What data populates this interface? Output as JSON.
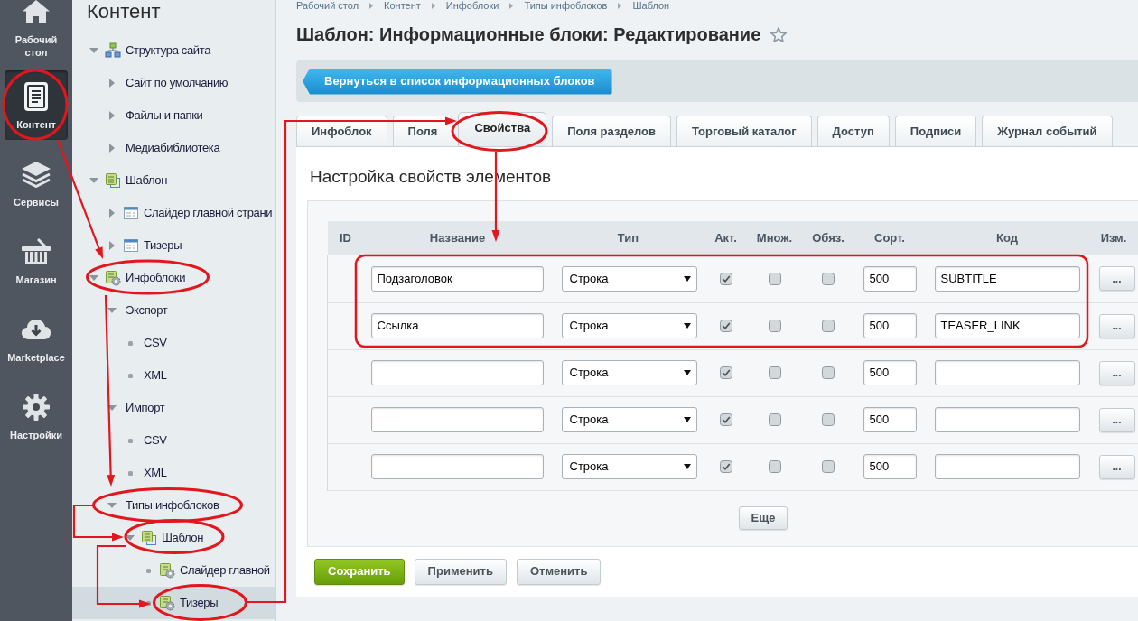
{
  "sidebar": {
    "items": [
      {
        "label": "Рабочий стол",
        "selected": false
      },
      {
        "label": "Контент",
        "selected": true
      },
      {
        "label": "Сервисы",
        "selected": false
      },
      {
        "label": "Магазин",
        "selected": false
      },
      {
        "label": "Marketplace",
        "selected": false
      },
      {
        "label": "Настройки",
        "selected": false
      }
    ]
  },
  "tree": {
    "title": "Контент",
    "items": [
      {
        "label": "Структура сайта",
        "kind": "structure",
        "expanded": true,
        "selected": false,
        "children": [
          {
            "label": "Сайт по умолчанию",
            "kind": "section",
            "expanded": false,
            "selected": false
          },
          {
            "label": "Файлы и папки",
            "kind": "section",
            "expanded": false,
            "selected": false
          },
          {
            "label": "Медиабиблиотека",
            "kind": "section",
            "expanded": false,
            "selected": false
          }
        ]
      },
      {
        "label": "Шаблон",
        "kind": "template",
        "expanded": true,
        "selected": false,
        "children": [
          {
            "label": "Слайдер главной страни",
            "kind": "iblock",
            "expanded": false,
            "selected": false
          },
          {
            "label": "Тизеры",
            "kind": "iblock",
            "expanded": false,
            "selected": false
          }
        ]
      },
      {
        "label": "Инфоблоки",
        "kind": "settings",
        "expanded": true,
        "selected": false,
        "children": [
          {
            "label": "Экспорт",
            "kind": "section",
            "expanded": true,
            "selected": false,
            "children": [
              {
                "label": "CSV",
                "kind": "page",
                "selected": false
              },
              {
                "label": "XML",
                "kind": "page",
                "selected": false
              }
            ]
          },
          {
            "label": "Импорт",
            "kind": "section",
            "expanded": true,
            "selected": false,
            "children": [
              {
                "label": "CSV",
                "kind": "page",
                "selected": false
              },
              {
                "label": "XML",
                "kind": "page",
                "selected": false
              }
            ]
          },
          {
            "label": "Типы инфоблоков",
            "kind": "section",
            "expanded": true,
            "selected": false,
            "children": [
              {
                "label": "Шаблон",
                "kind": "template",
                "expanded": true,
                "selected": false,
                "children": [
                  {
                    "label": "Слайдер главной",
                    "kind": "element",
                    "selected": false
                  },
                  {
                    "label": "Тизеры",
                    "kind": "element",
                    "selected": true
                  }
                ]
              }
            ]
          }
        ]
      }
    ]
  },
  "breadcrumbs": [
    "Рабочий стол",
    "Контент",
    "Инфоблоки",
    "Типы инфоблоков",
    "Шаблон"
  ],
  "page": {
    "title": "Шаблон: Информационные блоки: Редактирование",
    "starred": false
  },
  "back_button": "Вернуться в список информационных блоков",
  "tabs": [
    {
      "label": "Инфоблок",
      "selected": false
    },
    {
      "label": "Поля",
      "selected": false
    },
    {
      "label": "Свойства",
      "selected": true
    },
    {
      "label": "Поля разделов",
      "selected": false
    },
    {
      "label": "Торговый каталог",
      "selected": false
    },
    {
      "label": "Доступ",
      "selected": false
    },
    {
      "label": "Подписи",
      "selected": false
    },
    {
      "label": "Журнал событий",
      "selected": false
    }
  ],
  "section_title": "Настройка свойств элементов",
  "table": {
    "columns": [
      "ID",
      "Название",
      "Тип",
      "Акт.",
      "Множ.",
      "Обяз.",
      "Сорт.",
      "Код",
      "Изм."
    ],
    "rows": [
      {
        "name": "Подзаголовок",
        "type": "Строка",
        "active": true,
        "multiple": false,
        "required": false,
        "sort": "500",
        "code": "SUBTITLE",
        "edit": "..."
      },
      {
        "name": "Ссылка",
        "type": "Строка",
        "active": true,
        "multiple": false,
        "required": false,
        "sort": "500",
        "code": "TEASER_LINK",
        "edit": "..."
      },
      {
        "type": "Строка",
        "active": true,
        "multiple": false,
        "required": false,
        "sort": "500",
        "edit": "..."
      },
      {
        "type": "Строка",
        "active": true,
        "multiple": false,
        "required": false,
        "sort": "500",
        "edit": "..."
      },
      {
        "type": "Строка",
        "active": true,
        "multiple": false,
        "required": false,
        "sort": "500",
        "edit": "..."
      }
    ]
  },
  "more_button": "Еще",
  "buttons": [
    {
      "label": "Сохранить",
      "kind": "primary"
    },
    {
      "label": "Применить",
      "kind": "secondary"
    },
    {
      "label": "Отменить",
      "kind": "secondary"
    }
  ]
}
